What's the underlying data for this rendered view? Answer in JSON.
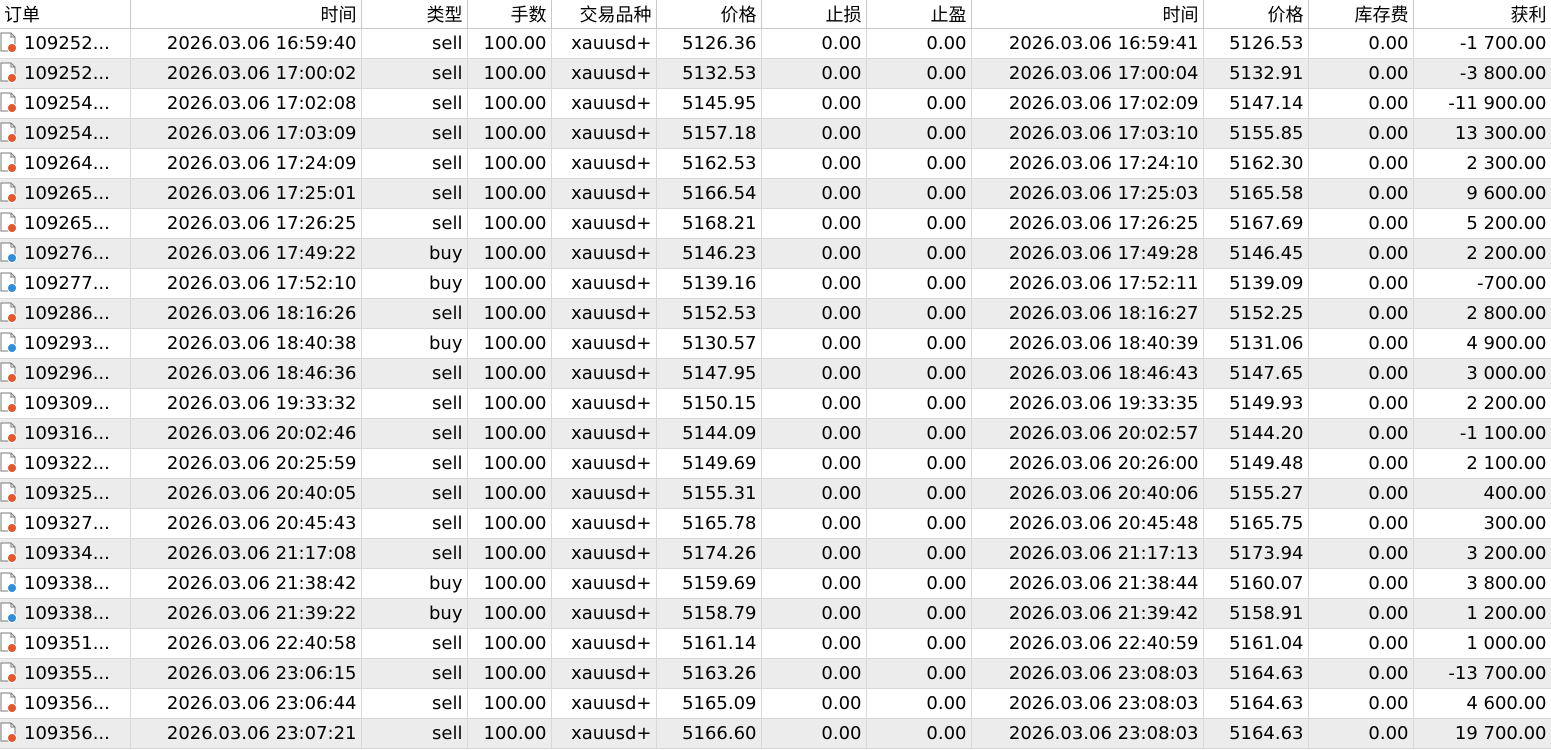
{
  "headers": [
    "订单",
    "时间",
    "类型",
    "手数",
    "交易品种",
    "价格",
    "止损",
    "止盈",
    "时间",
    "价格",
    "库存费",
    "获利"
  ],
  "colors": {
    "sell": "#e4572e",
    "buy": "#2f8fdc",
    "alt_row": "#ececec",
    "grid": "#d8d8d8"
  },
  "rows": [
    {
      "order": "109252...",
      "open_time": "2026.03.06 16:59:40",
      "type": "sell",
      "volume": "100.00",
      "symbol": "xauusd+",
      "open_price": "5126.36",
      "sl": "0.00",
      "tp": "0.00",
      "close_time": "2026.03.06 16:59:41",
      "close_price": "5126.53",
      "swap": "0.00",
      "profit": "-1 700.00"
    },
    {
      "order": "109252...",
      "open_time": "2026.03.06 17:00:02",
      "type": "sell",
      "volume": "100.00",
      "symbol": "xauusd+",
      "open_price": "5132.53",
      "sl": "0.00",
      "tp": "0.00",
      "close_time": "2026.03.06 17:00:04",
      "close_price": "5132.91",
      "swap": "0.00",
      "profit": "-3 800.00"
    },
    {
      "order": "109254...",
      "open_time": "2026.03.06 17:02:08",
      "type": "sell",
      "volume": "100.00",
      "symbol": "xauusd+",
      "open_price": "5145.95",
      "sl": "0.00",
      "tp": "0.00",
      "close_time": "2026.03.06 17:02:09",
      "close_price": "5147.14",
      "swap": "0.00",
      "profit": "-11 900.00"
    },
    {
      "order": "109254...",
      "open_time": "2026.03.06 17:03:09",
      "type": "sell",
      "volume": "100.00",
      "symbol": "xauusd+",
      "open_price": "5157.18",
      "sl": "0.00",
      "tp": "0.00",
      "close_time": "2026.03.06 17:03:10",
      "close_price": "5155.85",
      "swap": "0.00",
      "profit": "13 300.00"
    },
    {
      "order": "109264...",
      "open_time": "2026.03.06 17:24:09",
      "type": "sell",
      "volume": "100.00",
      "symbol": "xauusd+",
      "open_price": "5162.53",
      "sl": "0.00",
      "tp": "0.00",
      "close_time": "2026.03.06 17:24:10",
      "close_price": "5162.30",
      "swap": "0.00",
      "profit": "2 300.00"
    },
    {
      "order": "109265...",
      "open_time": "2026.03.06 17:25:01",
      "type": "sell",
      "volume": "100.00",
      "symbol": "xauusd+",
      "open_price": "5166.54",
      "sl": "0.00",
      "tp": "0.00",
      "close_time": "2026.03.06 17:25:03",
      "close_price": "5165.58",
      "swap": "0.00",
      "profit": "9 600.00"
    },
    {
      "order": "109265...",
      "open_time": "2026.03.06 17:26:25",
      "type": "sell",
      "volume": "100.00",
      "symbol": "xauusd+",
      "open_price": "5168.21",
      "sl": "0.00",
      "tp": "0.00",
      "close_time": "2026.03.06 17:26:25",
      "close_price": "5167.69",
      "swap": "0.00",
      "profit": "5 200.00"
    },
    {
      "order": "109276...",
      "open_time": "2026.03.06 17:49:22",
      "type": "buy",
      "volume": "100.00",
      "symbol": "xauusd+",
      "open_price": "5146.23",
      "sl": "0.00",
      "tp": "0.00",
      "close_time": "2026.03.06 17:49:28",
      "close_price": "5146.45",
      "swap": "0.00",
      "profit": "2 200.00"
    },
    {
      "order": "109277...",
      "open_time": "2026.03.06 17:52:10",
      "type": "buy",
      "volume": "100.00",
      "symbol": "xauusd+",
      "open_price": "5139.16",
      "sl": "0.00",
      "tp": "0.00",
      "close_time": "2026.03.06 17:52:11",
      "close_price": "5139.09",
      "swap": "0.00",
      "profit": "-700.00"
    },
    {
      "order": "109286...",
      "open_time": "2026.03.06 18:16:26",
      "type": "sell",
      "volume": "100.00",
      "symbol": "xauusd+",
      "open_price": "5152.53",
      "sl": "0.00",
      "tp": "0.00",
      "close_time": "2026.03.06 18:16:27",
      "close_price": "5152.25",
      "swap": "0.00",
      "profit": "2 800.00"
    },
    {
      "order": "109293...",
      "open_time": "2026.03.06 18:40:38",
      "type": "buy",
      "volume": "100.00",
      "symbol": "xauusd+",
      "open_price": "5130.57",
      "sl": "0.00",
      "tp": "0.00",
      "close_time": "2026.03.06 18:40:39",
      "close_price": "5131.06",
      "swap": "0.00",
      "profit": "4 900.00"
    },
    {
      "order": "109296...",
      "open_time": "2026.03.06 18:46:36",
      "type": "sell",
      "volume": "100.00",
      "symbol": "xauusd+",
      "open_price": "5147.95",
      "sl": "0.00",
      "tp": "0.00",
      "close_time": "2026.03.06 18:46:43",
      "close_price": "5147.65",
      "swap": "0.00",
      "profit": "3 000.00"
    },
    {
      "order": "109309...",
      "open_time": "2026.03.06 19:33:32",
      "type": "sell",
      "volume": "100.00",
      "symbol": "xauusd+",
      "open_price": "5150.15",
      "sl": "0.00",
      "tp": "0.00",
      "close_time": "2026.03.06 19:33:35",
      "close_price": "5149.93",
      "swap": "0.00",
      "profit": "2 200.00"
    },
    {
      "order": "109316...",
      "open_time": "2026.03.06 20:02:46",
      "type": "sell",
      "volume": "100.00",
      "symbol": "xauusd+",
      "open_price": "5144.09",
      "sl": "0.00",
      "tp": "0.00",
      "close_time": "2026.03.06 20:02:57",
      "close_price": "5144.20",
      "swap": "0.00",
      "profit": "-1 100.00"
    },
    {
      "order": "109322...",
      "open_time": "2026.03.06 20:25:59",
      "type": "sell",
      "volume": "100.00",
      "symbol": "xauusd+",
      "open_price": "5149.69",
      "sl": "0.00",
      "tp": "0.00",
      "close_time": "2026.03.06 20:26:00",
      "close_price": "5149.48",
      "swap": "0.00",
      "profit": "2 100.00"
    },
    {
      "order": "109325...",
      "open_time": "2026.03.06 20:40:05",
      "type": "sell",
      "volume": "100.00",
      "symbol": "xauusd+",
      "open_price": "5155.31",
      "sl": "0.00",
      "tp": "0.00",
      "close_time": "2026.03.06 20:40:06",
      "close_price": "5155.27",
      "swap": "0.00",
      "profit": "400.00"
    },
    {
      "order": "109327...",
      "open_time": "2026.03.06 20:45:43",
      "type": "sell",
      "volume": "100.00",
      "symbol": "xauusd+",
      "open_price": "5165.78",
      "sl": "0.00",
      "tp": "0.00",
      "close_time": "2026.03.06 20:45:48",
      "close_price": "5165.75",
      "swap": "0.00",
      "profit": "300.00"
    },
    {
      "order": "109334...",
      "open_time": "2026.03.06 21:17:08",
      "type": "sell",
      "volume": "100.00",
      "symbol": "xauusd+",
      "open_price": "5174.26",
      "sl": "0.00",
      "tp": "0.00",
      "close_time": "2026.03.06 21:17:13",
      "close_price": "5173.94",
      "swap": "0.00",
      "profit": "3 200.00"
    },
    {
      "order": "109338...",
      "open_time": "2026.03.06 21:38:42",
      "type": "buy",
      "volume": "100.00",
      "symbol": "xauusd+",
      "open_price": "5159.69",
      "sl": "0.00",
      "tp": "0.00",
      "close_time": "2026.03.06 21:38:44",
      "close_price": "5160.07",
      "swap": "0.00",
      "profit": "3 800.00"
    },
    {
      "order": "109338...",
      "open_time": "2026.03.06 21:39:22",
      "type": "buy",
      "volume": "100.00",
      "symbol": "xauusd+",
      "open_price": "5158.79",
      "sl": "0.00",
      "tp": "0.00",
      "close_time": "2026.03.06 21:39:42",
      "close_price": "5158.91",
      "swap": "0.00",
      "profit": "1 200.00"
    },
    {
      "order": "109351...",
      "open_time": "2026.03.06 22:40:58",
      "type": "sell",
      "volume": "100.00",
      "symbol": "xauusd+",
      "open_price": "5161.14",
      "sl": "0.00",
      "tp": "0.00",
      "close_time": "2026.03.06 22:40:59",
      "close_price": "5161.04",
      "swap": "0.00",
      "profit": "1 000.00"
    },
    {
      "order": "109355...",
      "open_time": "2026.03.06 23:06:15",
      "type": "sell",
      "volume": "100.00",
      "symbol": "xauusd+",
      "open_price": "5163.26",
      "sl": "0.00",
      "tp": "0.00",
      "close_time": "2026.03.06 23:08:03",
      "close_price": "5164.63",
      "swap": "0.00",
      "profit": "-13 700.00"
    },
    {
      "order": "109356...",
      "open_time": "2026.03.06 23:06:44",
      "type": "sell",
      "volume": "100.00",
      "symbol": "xauusd+",
      "open_price": "5165.09",
      "sl": "0.00",
      "tp": "0.00",
      "close_time": "2026.03.06 23:08:03",
      "close_price": "5164.63",
      "swap": "0.00",
      "profit": "4 600.00"
    },
    {
      "order": "109356...",
      "open_time": "2026.03.06 23:07:21",
      "type": "sell",
      "volume": "100.00",
      "symbol": "xauusd+",
      "open_price": "5166.60",
      "sl": "0.00",
      "tp": "0.00",
      "close_time": "2026.03.06 23:08:03",
      "close_price": "5164.63",
      "swap": "0.00",
      "profit": "19 700.00"
    }
  ]
}
